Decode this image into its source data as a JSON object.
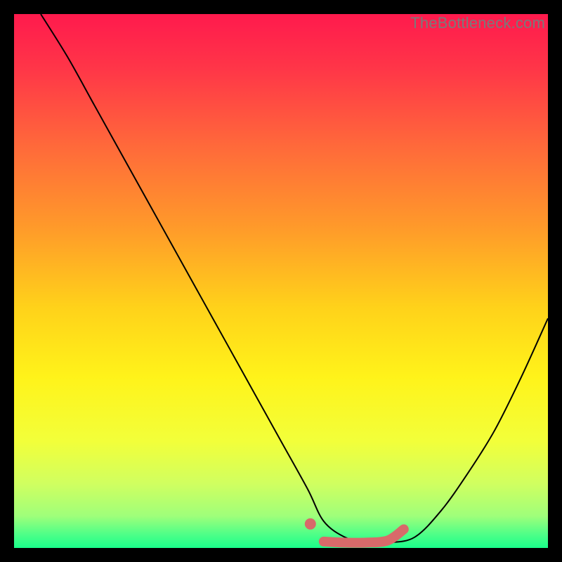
{
  "watermark": "TheBottleneck.com",
  "gradient_stops": [
    {
      "offset": 0.0,
      "color": "#ff1a4d"
    },
    {
      "offset": 0.1,
      "color": "#ff3548"
    },
    {
      "offset": 0.25,
      "color": "#ff6a3a"
    },
    {
      "offset": 0.4,
      "color": "#ff9a2a"
    },
    {
      "offset": 0.55,
      "color": "#ffd21a"
    },
    {
      "offset": 0.68,
      "color": "#fff31a"
    },
    {
      "offset": 0.8,
      "color": "#f2ff3a"
    },
    {
      "offset": 0.88,
      "color": "#d0ff60"
    },
    {
      "offset": 0.94,
      "color": "#9fff7a"
    },
    {
      "offset": 0.975,
      "color": "#4dff88"
    },
    {
      "offset": 1.0,
      "color": "#1aff8a"
    }
  ],
  "chart_data": {
    "type": "line",
    "title": "",
    "xlabel": "",
    "ylabel": "",
    "xlim": [
      0,
      100
    ],
    "ylim": [
      0,
      100
    ],
    "grid": false,
    "series": [
      {
        "name": "bottleneck-curve",
        "color": "#000000",
        "width": 2,
        "x": [
          5,
          10,
          15,
          20,
          25,
          30,
          35,
          40,
          45,
          50,
          55,
          58,
          62,
          66,
          70,
          75,
          80,
          85,
          90,
          95,
          100
        ],
        "y": [
          100,
          92,
          83,
          74,
          65,
          56,
          47,
          38,
          29,
          20,
          11,
          5,
          2,
          1,
          1,
          2,
          7,
          14,
          22,
          32,
          43
        ]
      },
      {
        "name": "highlight-dot",
        "color": "#d86a6a",
        "type": "scatter",
        "radius": 8,
        "x": [
          55.5
        ],
        "y": [
          4.5
        ]
      },
      {
        "name": "highlight-band",
        "color": "#d86a6a",
        "width": 14,
        "linecap": "round",
        "x": [
          58,
          62,
          66,
          70,
          73
        ],
        "y": [
          1.2,
          1.0,
          1.0,
          1.4,
          3.5
        ]
      }
    ]
  }
}
